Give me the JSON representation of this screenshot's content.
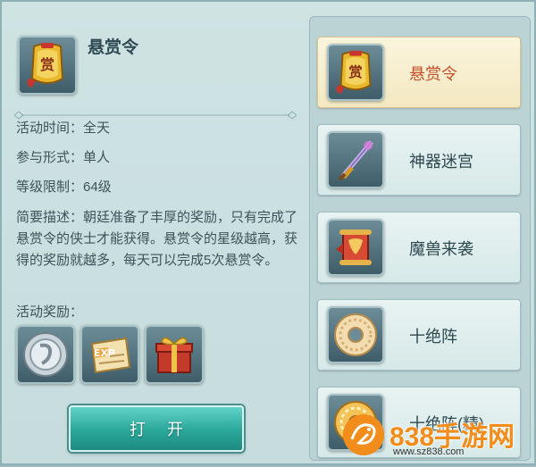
{
  "activity": {
    "title": "悬赏令",
    "icon": "bounty-token-icon",
    "time_line": "活动时间：全天",
    "mode_line": "参与形式：单人",
    "level_line": "等级限制：64级",
    "description": "简要描述：朝廷准备了丰厚的奖励，只有完成了悬赏令的侠士才能获得。悬赏令的星级越高，获得的奖励就越多，每天可以完成5次悬赏令。",
    "rewards_label": "活动奖励：",
    "rewards": [
      {
        "icon": "silver-coin-icon"
      },
      {
        "icon": "exp-scroll-icon",
        "text": "EXP"
      },
      {
        "icon": "gift-box-icon"
      }
    ],
    "open_button": "打开"
  },
  "activity_list": {
    "selected_index": 0,
    "items": [
      {
        "label": "悬赏令",
        "icon": "bounty-token-icon"
      },
      {
        "label": "神器迷宫",
        "icon": "divine-sword-icon"
      },
      {
        "label": "魔兽来袭",
        "icon": "demon-scroll-icon"
      },
      {
        "label": "十绝阵",
        "icon": "jade-disc-icon"
      },
      {
        "label": "十绝阵(精)",
        "icon": "gold-disc-icon"
      }
    ]
  },
  "watermark": {
    "brand": "838手游网",
    "url": "www.sz838.com"
  },
  "colors": {
    "panel_bg": "#cfe3e3",
    "active_tab_text": "#c4502c",
    "button": "#2aa79a",
    "watermark_orange": "#f28c1a"
  }
}
